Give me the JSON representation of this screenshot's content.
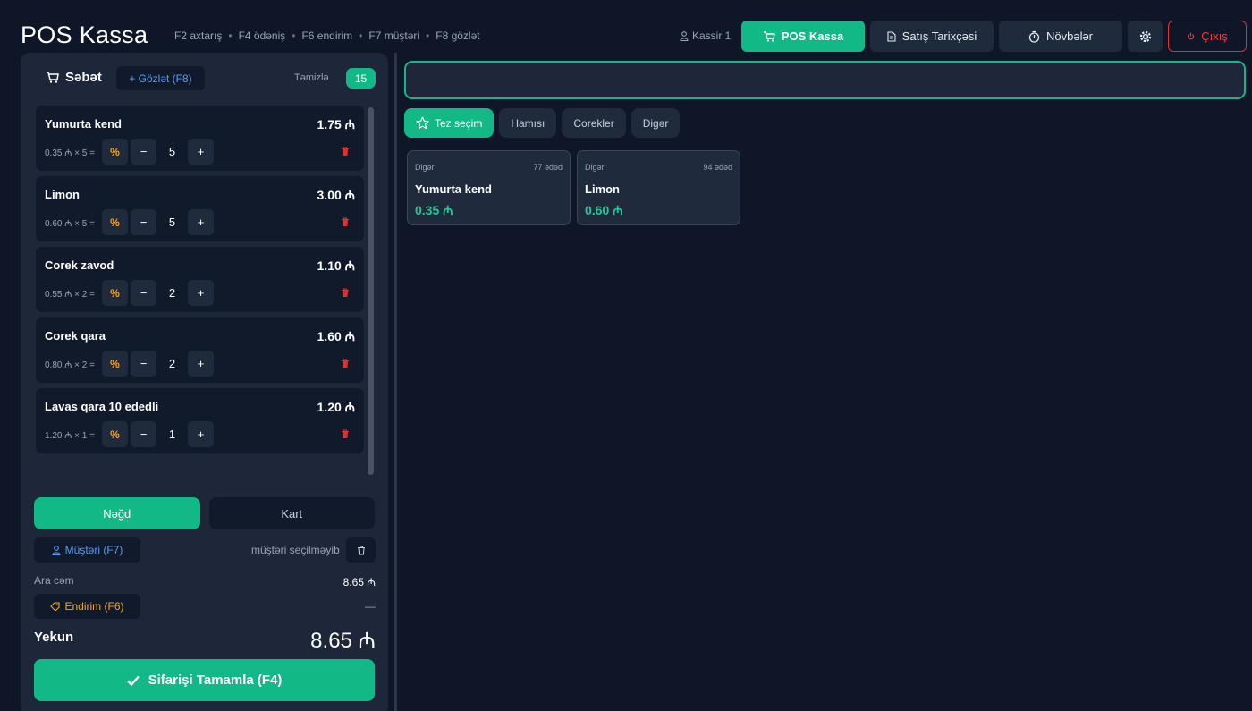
{
  "header": {
    "title": "POS Kassa",
    "shortcuts": [
      "F2 axtarış",
      "F4 ödəniş",
      "F6 endirim",
      "F7 müştəri",
      "F8 gözlət"
    ],
    "cashier": "Kassir 1",
    "nav": {
      "pos": "POS Kassa",
      "history": "Satış Tarixçəsi",
      "shifts": "Növbələr",
      "logout": "Çıxış"
    }
  },
  "cart": {
    "title": "Səbət",
    "hold_label": "+ Gözlət (F8)",
    "clear_label": "Təmizlə",
    "count": "15",
    "items": [
      {
        "name": "Yumurta kend",
        "unit": "0.35 ₼ × 5 =",
        "qty": "5",
        "total": "1.75 ₼"
      },
      {
        "name": "Limon",
        "unit": "0.60 ₼ × 5 =",
        "qty": "5",
        "total": "3.00 ₼"
      },
      {
        "name": "Corek zavod",
        "unit": "0.55 ₼ × 2 =",
        "qty": "2",
        "total": "1.10 ₼"
      },
      {
        "name": "Corek qara",
        "unit": "0.80 ₼ × 2 =",
        "qty": "2",
        "total": "1.60 ₼"
      },
      {
        "name": "Lavas qara 10 ededli",
        "unit": "1.20 ₼ × 1 =",
        "qty": "1",
        "total": "1.20 ₼"
      }
    ],
    "discount_symbol": "%",
    "minus": "−",
    "plus": "+"
  },
  "payment": {
    "cash": "Nəğd",
    "card": "Kart",
    "customer_button": "Müştəri (F7)",
    "customer_status": "müştəri seçilməyib",
    "subtotal_label": "Ara cəm",
    "subtotal_value": "8.65 ₼",
    "discount_button": "Endirim (F6)",
    "discount_value": "—",
    "total_label": "Yekun",
    "total_value": "8.65 ₼",
    "complete_button": "Sifarişi Tamamla (F4)"
  },
  "products": {
    "search_placeholder": "",
    "categories": [
      "Tez seçim",
      "Hamısı",
      "Corekler",
      "Digər"
    ],
    "items": [
      {
        "category": "Digər",
        "stock": "77 ədəd",
        "name": "Yumurta kend",
        "price": "0.35 ₼"
      },
      {
        "category": "Digər",
        "stock": "94 ədəd",
        "name": "Limon",
        "price": "0.60 ₼"
      }
    ]
  },
  "colors": {
    "accent": "#12b886",
    "background": "#0f1628",
    "panel": "#1d2739",
    "danger": "#e03131",
    "warning": "#f5a623",
    "link": "#5b9cf6"
  }
}
